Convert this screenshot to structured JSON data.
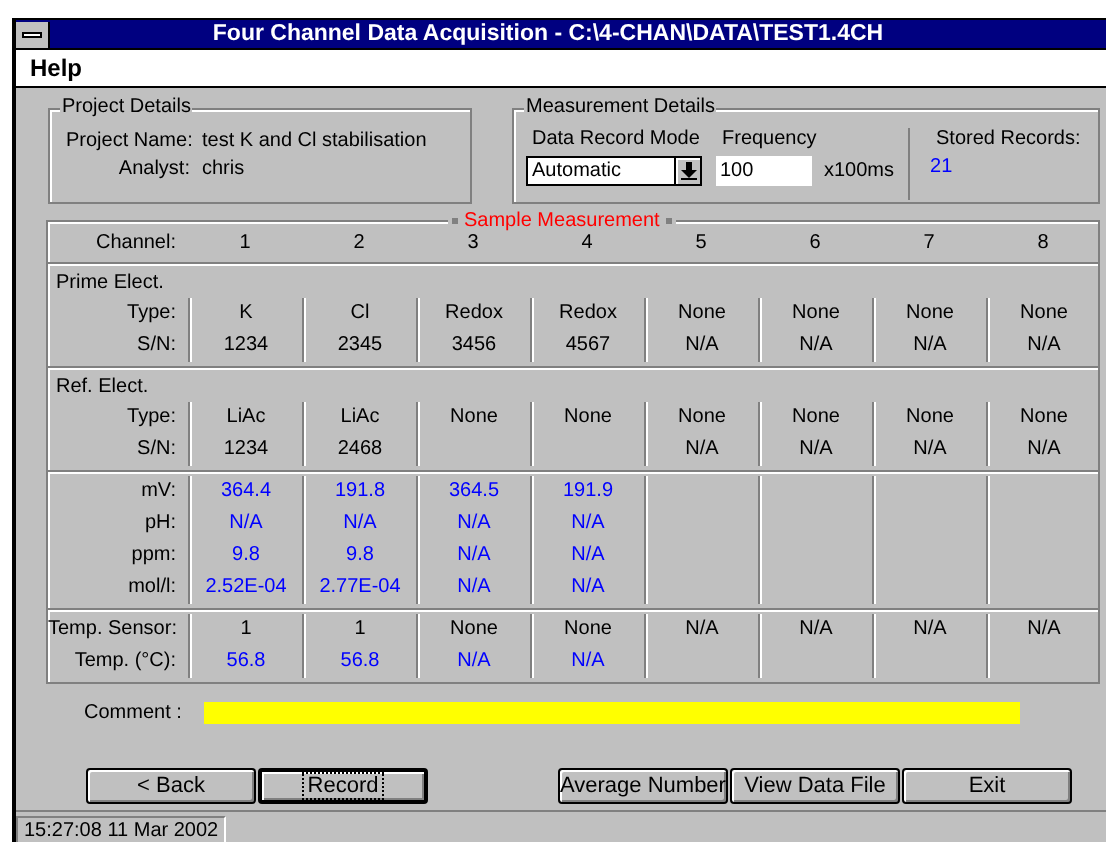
{
  "window": {
    "title": "Four Channel Data Acquisition - C:\\4-CHAN\\DATA\\TEST1.4CH"
  },
  "menu": [
    {
      "label": "Help"
    }
  ],
  "project": {
    "legend": "Project Details",
    "fields": [
      {
        "label": "Project Name:",
        "value": "test K and Cl stabilisation"
      },
      {
        "label": "Analyst:",
        "value": "chris"
      }
    ]
  },
  "measurement": {
    "legend": "Measurement Details",
    "mode_label": "Data Record Mode",
    "mode_value": "Automatic",
    "frequency_label": "Frequency",
    "frequency_value": "100",
    "frequency_unit": "x100ms",
    "stored_label": "Stored Records:",
    "stored_value": "21"
  },
  "sample": {
    "legend": "Sample Measurement",
    "channel_label": "Channel:",
    "channels": [
      "1",
      "2",
      "3",
      "4",
      "5",
      "6",
      "7",
      "8"
    ],
    "sections": [
      {
        "title": "Prime Elect.",
        "rows": [
          {
            "label": "Type:",
            "kind": "plain",
            "cells": [
              "K",
              "Cl",
              "Redox",
              "Redox",
              "None",
              "None",
              "None",
              "None"
            ]
          },
          {
            "label": "S/N:",
            "kind": "plain",
            "cells": [
              "1234",
              "2345",
              "3456",
              "4567",
              "N/A",
              "N/A",
              "N/A",
              "N/A"
            ]
          }
        ]
      },
      {
        "title": "Ref. Elect.",
        "rows": [
          {
            "label": "Type:",
            "kind": "plain",
            "cells": [
              "LiAc",
              "LiAc",
              "None",
              "None",
              "None",
              "None",
              "None",
              "None"
            ]
          },
          {
            "label": "S/N:",
            "kind": "plain",
            "cells": [
              "1234",
              "2468",
              null,
              null,
              "N/A",
              "N/A",
              "N/A",
              "N/A"
            ]
          }
        ]
      },
      {
        "rows": [
          {
            "label": "mV:",
            "kind": "reading",
            "cells": [
              "364.4",
              "191.8",
              "364.5",
              "191.9"
            ]
          },
          {
            "label": "pH:",
            "kind": "reading",
            "cells": [
              "N/A",
              "N/A",
              "N/A",
              "N/A"
            ]
          },
          {
            "label": "ppm:",
            "kind": "reading",
            "cells": [
              "9.8",
              "9.8",
              "N/A",
              "N/A"
            ]
          },
          {
            "label": "mol/l:",
            "kind": "reading",
            "cells": [
              "2.52E-04",
              "2.77E-04",
              "N/A",
              "N/A"
            ]
          }
        ]
      },
      {
        "rows": [
          {
            "label": "Temp. Sensor:",
            "kind": "plain",
            "cells": [
              "1",
              "1",
              "None",
              "None",
              "N/A",
              "N/A",
              "N/A",
              "N/A"
            ]
          },
          {
            "label": "Temp. (°C):",
            "kind": "reading",
            "cells": [
              "56.8",
              "56.8",
              "N/A",
              "N/A"
            ]
          }
        ]
      }
    ]
  },
  "comment": {
    "label": "Comment :"
  },
  "buttons_left": [
    {
      "label": "< Back",
      "default": false
    },
    {
      "label": "Record",
      "default": true
    }
  ],
  "buttons_right": [
    {
      "label": "Average Number",
      "default": false
    },
    {
      "label": "View Data File",
      "default": false
    },
    {
      "label": "Exit",
      "default": false
    }
  ],
  "status_bar": "15:27:08 11 Mar 2002"
}
